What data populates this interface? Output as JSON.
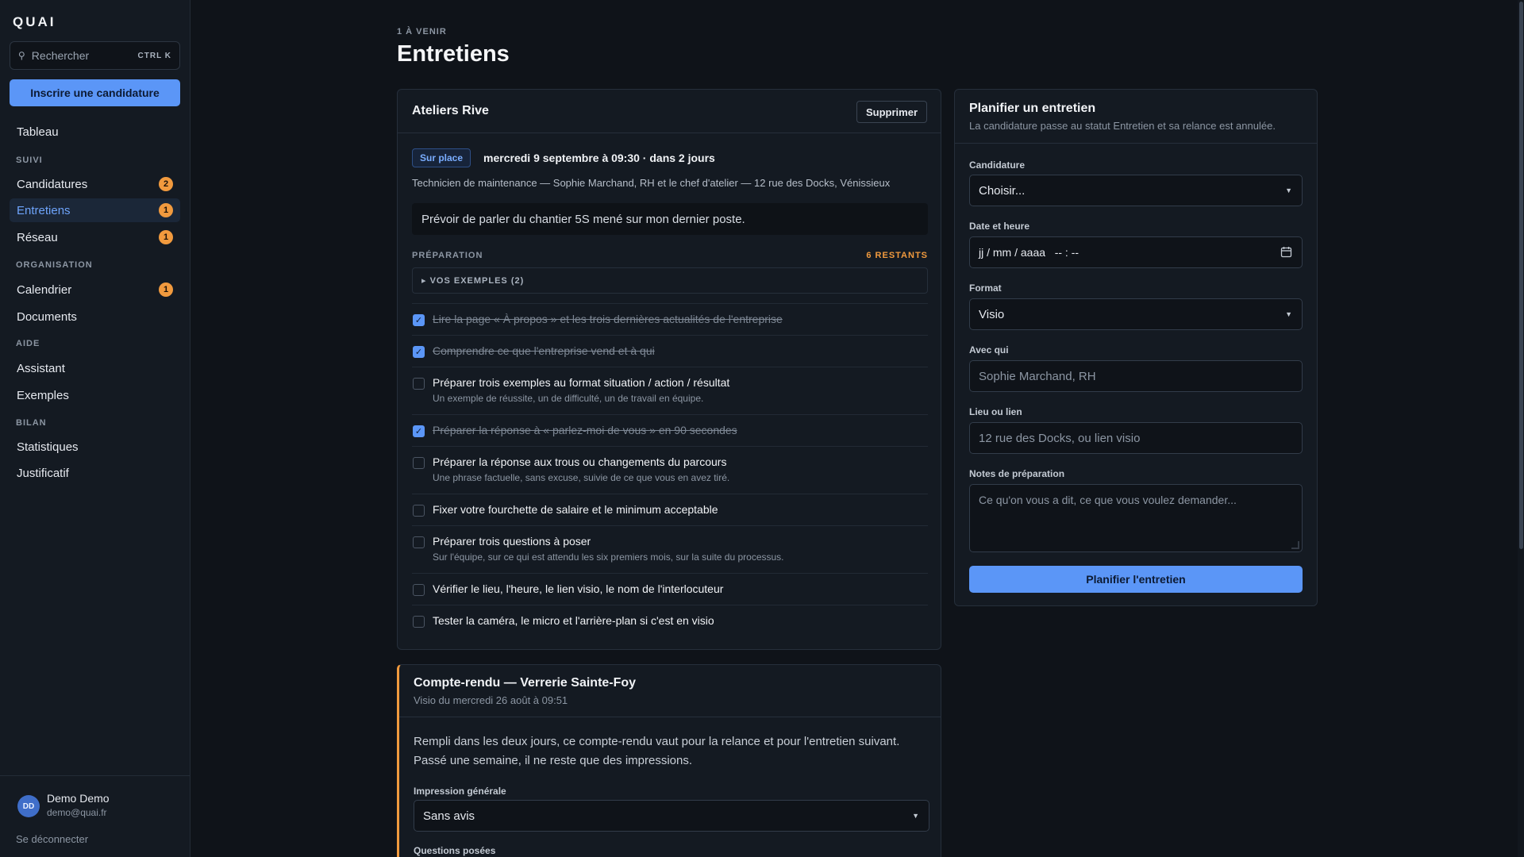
{
  "app": {
    "logo": "QUAI"
  },
  "sidebar": {
    "search_placeholder": "Rechercher",
    "search_shortcut": "CTRL K",
    "cta_label": "Inscrire une candidature",
    "top_item": {
      "label": "Tableau"
    },
    "sections": [
      {
        "title": "SUIVI",
        "items": [
          {
            "label": "Candidatures",
            "badge": "2"
          },
          {
            "label": "Entretiens",
            "badge": "1",
            "active": true
          },
          {
            "label": "Réseau",
            "badge": "1"
          }
        ]
      },
      {
        "title": "ORGANISATION",
        "items": [
          {
            "label": "Calendrier",
            "badge": "1"
          },
          {
            "label": "Documents"
          }
        ]
      },
      {
        "title": "AIDE",
        "items": [
          {
            "label": "Assistant"
          },
          {
            "label": "Exemples"
          }
        ]
      },
      {
        "title": "BILAN",
        "items": [
          {
            "label": "Statistiques"
          },
          {
            "label": "Justificatif"
          }
        ]
      }
    ],
    "user": {
      "initials": "DD",
      "name": "Demo Demo",
      "email": "demo@quai.fr"
    },
    "logout_label": "Se déconnecter"
  },
  "header": {
    "kicker": "1 À VENIR",
    "title": "Entretiens"
  },
  "interview": {
    "company": "Ateliers Rive",
    "delete_label": "Supprimer",
    "format_chip": "Sur place",
    "when": "mercredi 9 septembre à 09:30 · dans 2 jours",
    "details": "Technicien de maintenance — Sophie Marchand, RH et le chef d'atelier — 12 rue des Docks, Vénissieux",
    "note": "Prévoir de parler du chantier 5S mené sur mon dernier poste.",
    "prep_label": "PRÉPARATION",
    "prep_remaining": "6 RESTANTS",
    "examples_toggle": "▸ VOS EXEMPLES (2)",
    "tasks": [
      {
        "title": "Lire la page « À propos » et les trois dernières actualités de l'entreprise",
        "done": true
      },
      {
        "title": "Comprendre ce que l'entreprise vend et à qui",
        "done": true
      },
      {
        "title": "Préparer trois exemples au format situation / action / résultat",
        "sub": "Un exemple de réussite, un de difficulté, un de travail en équipe.",
        "done": false
      },
      {
        "title": "Préparer la réponse à « parlez-moi de vous » en 90 secondes",
        "done": true
      },
      {
        "title": "Préparer la réponse aux trous ou changements du parcours",
        "sub": "Une phrase factuelle, sans excuse, suivie de ce que vous en avez tiré.",
        "done": false
      },
      {
        "title": "Fixer votre fourchette de salaire et le minimum acceptable",
        "done": false
      },
      {
        "title": "Préparer trois questions à poser",
        "sub": "Sur l'équipe, sur ce qui est attendu les six premiers mois, sur la suite du processus.",
        "done": false
      },
      {
        "title": "Vérifier le lieu, l'heure, le lien visio, le nom de l'interlocuteur",
        "done": false
      },
      {
        "title": "Tester la caméra, le micro et l'arrière-plan si c'est en visio",
        "done": false
      }
    ]
  },
  "report": {
    "title": "Compte-rendu — Verrerie Sainte-Foy",
    "subtitle": "Visio du mercredi 26 août à 09:51",
    "intro": "Rempli dans les deux jours, ce compte-rendu vaut pour la relance et pour l'entretien suivant. Passé une semaine, il ne reste que des impressions.",
    "impression_label": "Impression générale",
    "impression_value": "Sans avis",
    "questions_label": "Questions posées"
  },
  "planner": {
    "title": "Planifier un entretien",
    "subtitle": "La candidature passe au statut Entretien et sa relance est annulée.",
    "candidature_label": "Candidature",
    "candidature_value": "Choisir...",
    "datetime_label": "Date et heure",
    "datetime_placeholder": "jj / mm / aaaa   -- : --",
    "format_label": "Format",
    "format_value": "Visio",
    "with_label": "Avec qui",
    "with_placeholder": "Sophie Marchand, RH",
    "place_label": "Lieu ou lien",
    "place_placeholder": "12 rue des Docks, ou lien visio",
    "notes_label": "Notes de préparation",
    "notes_placeholder": "Ce qu'on vous a dit, ce que vous voulez demander...",
    "submit_label": "Planifier l'entretien"
  },
  "colors": {
    "accent": "#5b96f7",
    "badge": "#f19a3e",
    "background": "#0f1319",
    "surface": "#141a22"
  }
}
